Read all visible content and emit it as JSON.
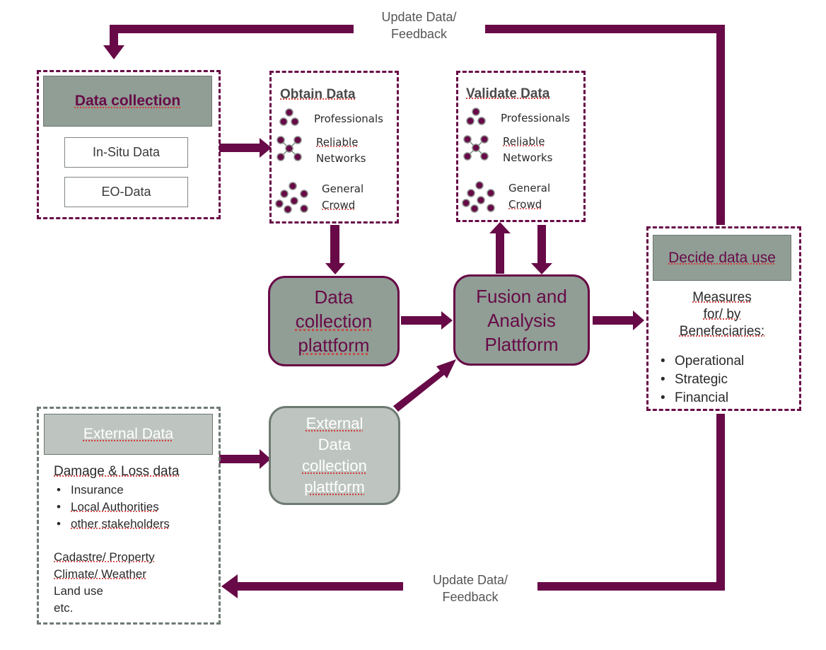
{
  "colors": {
    "accent": "#680a47",
    "header_fill": "#909e95",
    "external_fill": "#bec5c0",
    "external_border": "#6e7a72"
  },
  "feedback_top": {
    "line1": "Update Data/",
    "line2": "Feedback"
  },
  "feedback_bottom": {
    "line1": "Update Data/",
    "line2": "Feedback"
  },
  "data_collection": {
    "title": "Data collection",
    "items": [
      "In-Situ Data",
      "EO-Data"
    ]
  },
  "obtain_data": {
    "title": "Obtain Data",
    "items": [
      {
        "icon": "professionals-icon",
        "line1": "Professionals",
        "line2": ""
      },
      {
        "icon": "network-icon",
        "line1": "Reliable",
        "line2": "Networks"
      },
      {
        "icon": "crowd-icon",
        "line1": "General",
        "line2": "Crowd"
      }
    ]
  },
  "validate_data": {
    "title": "Validate Data",
    "items": [
      {
        "icon": "professionals-icon",
        "line1": "Professionals",
        "line2": ""
      },
      {
        "icon": "network-icon",
        "line1": "Reliable",
        "line2": "Networks"
      },
      {
        "icon": "crowd-icon",
        "line1": "General",
        "line2": "Crowd"
      }
    ]
  },
  "collection_platform": {
    "lines": [
      "Data",
      "collection",
      "plattform"
    ]
  },
  "fusion_platform": {
    "lines": [
      "Fusion and",
      "Analysis",
      "Plattform"
    ]
  },
  "external_platform": {
    "lines": [
      "External",
      "Data",
      "collection",
      "plattform"
    ]
  },
  "decide": {
    "title": "Decide data use",
    "measures": [
      "Measures",
      "for/ by",
      "Benefeciaries:"
    ],
    "bullets": [
      "Operational",
      "Strategic",
      "Financial"
    ]
  },
  "external_data": {
    "title": "External Data",
    "damage_heading": "Damage & Loss data",
    "damage_bullets": [
      "Insurance",
      "Local Authorities",
      "other stakeholders"
    ],
    "other": [
      "Cadastre/ Property",
      "Climate/ Weather",
      "Land use",
      "etc."
    ]
  }
}
